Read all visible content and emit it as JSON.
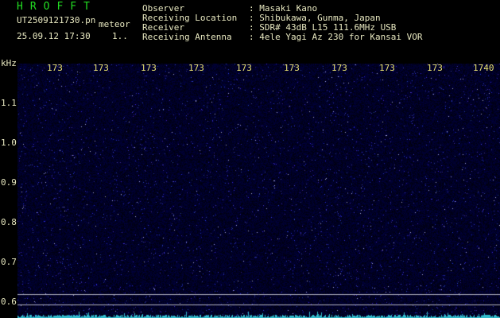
{
  "header": {
    "title": "HROFFT",
    "filename": "UT2509121730.pn",
    "mode": "meteor",
    "datetime": "25.09.12 17:30",
    "counter": "1.."
  },
  "info": [
    {
      "label": "Observer",
      "value": ": Masaki Kano"
    },
    {
      "label": "Receiving Location",
      "value": ": Shibukawa, Gunma, Japan"
    },
    {
      "label": "Receiver",
      "value": ": SDR# 43dB L15 111.6MHz USB"
    },
    {
      "label": "Receiving Antenna",
      "value": ": 4ele Yagi Az 230 for Kansai VOR"
    }
  ],
  "axis": {
    "y_unit": "kHz",
    "y_ticks": [
      "1.1",
      "1.0",
      "0.9",
      "0.8",
      "0.7",
      "0.6"
    ],
    "x_ticks": [
      "173",
      "173",
      "173",
      "173",
      "173",
      "173",
      "173",
      "173",
      "173",
      "173",
      "1740"
    ]
  },
  "colors": {
    "background": "#000000",
    "title": "#22dd22",
    "text": "#e8e8c0",
    "x_ticks": "#e8e070",
    "noise_floor": "#0a0a46",
    "baseline_trace": "#33bbcc",
    "reference_lines": "#b0b0c0"
  }
}
